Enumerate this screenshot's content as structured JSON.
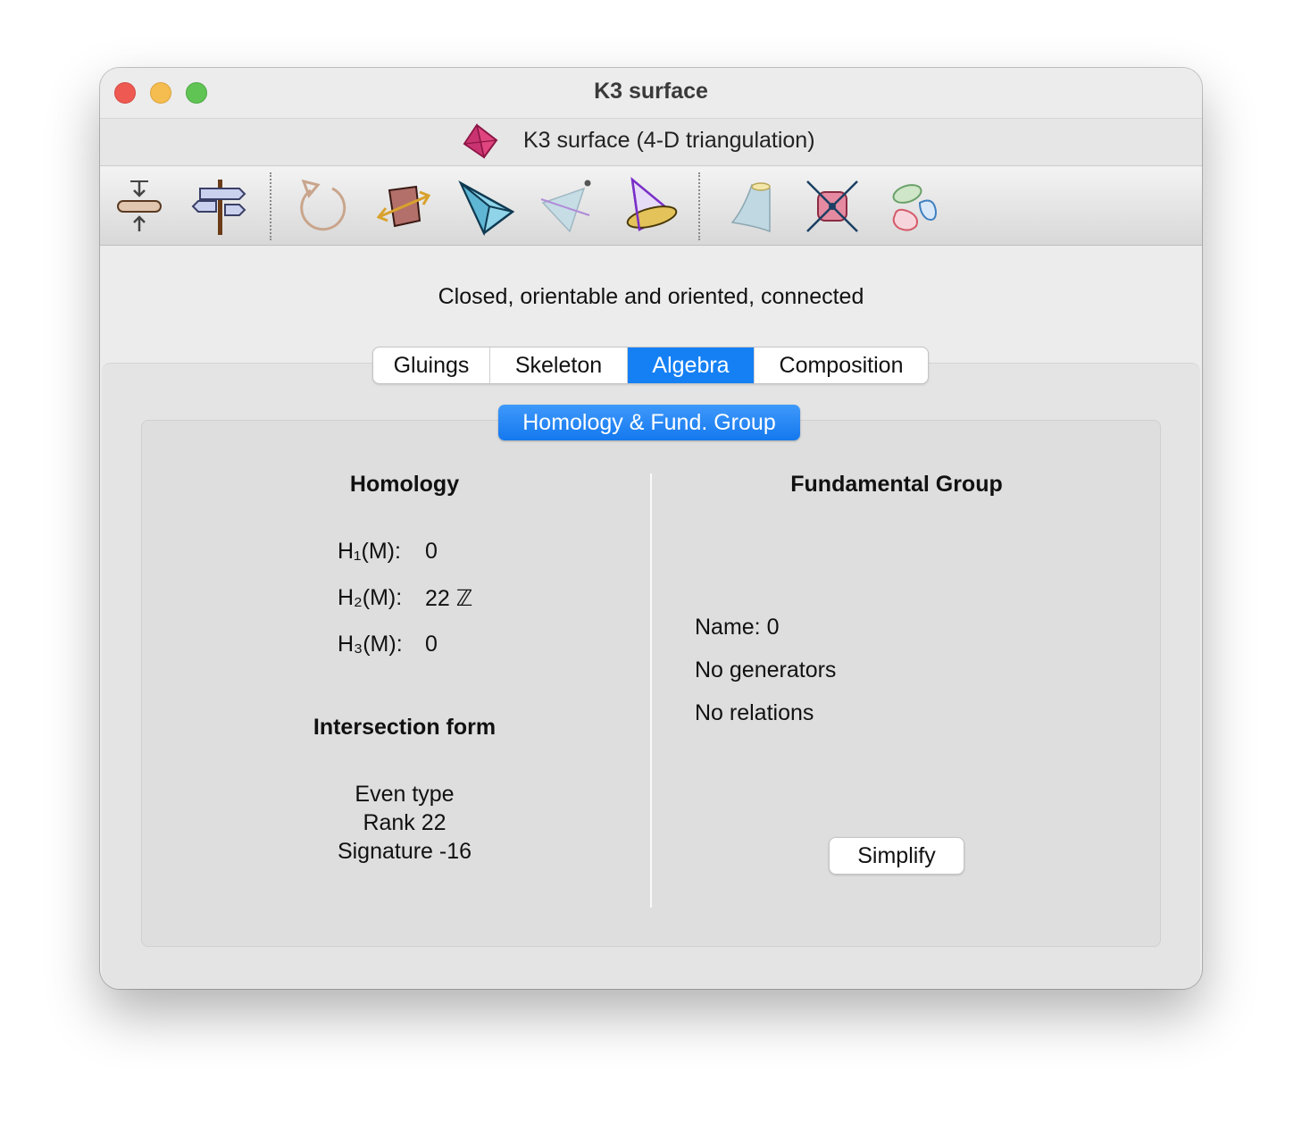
{
  "window": {
    "title": "K3 surface",
    "header_title": "K3 surface (4-D triangulation)",
    "header_icon": "pentachoron-icon"
  },
  "toolbar": {
    "tools": [
      {
        "icon": "collapse-arrows-icon"
      },
      {
        "icon": "signpost-icon"
      },
      {
        "icon": "rotate-orientation-icon"
      },
      {
        "icon": "reflect-arrows-icon"
      },
      {
        "icon": "tetrahedron-icon"
      },
      {
        "icon": "cone-vertex-icon"
      },
      {
        "icon": "disc-tetrahedron-icon"
      },
      {
        "icon": "cone-surface-icon"
      },
      {
        "icon": "crossed-simplex-icon"
      },
      {
        "icon": "components-blobs-icon"
      }
    ]
  },
  "status": "Closed, orientable and oriented, connected",
  "tabs": [
    "Gluings",
    "Skeleton",
    "Algebra",
    "Composition"
  ],
  "active_tab": "Algebra",
  "subtab": "Homology & Fund. Group",
  "homology": {
    "heading": "Homology",
    "rows": [
      {
        "label": "H₁(M):",
        "value": "0"
      },
      {
        "label": "H₂(M):",
        "value": "22 ℤ"
      },
      {
        "label": "H₃(M):",
        "value": "0"
      }
    ]
  },
  "intersection": {
    "heading": "Intersection form",
    "lines": [
      "Even type",
      "Rank 22",
      "Signature -16"
    ]
  },
  "fundamental_group": {
    "heading": "Fundamental Group",
    "name": "Name: 0",
    "generators": "No generators",
    "relations": "No relations",
    "simplify_label": "Simplify"
  },
  "colors": {
    "accent": "#1580f4",
    "close": "#ee5a52",
    "minimize": "#f5bd4f",
    "maximize": "#60c454"
  }
}
